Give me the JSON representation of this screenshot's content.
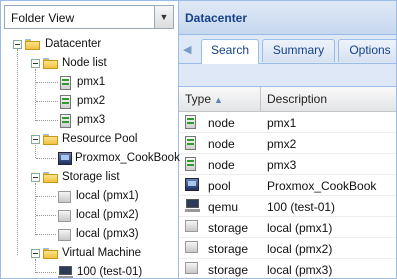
{
  "view_select": {
    "value": "Folder View"
  },
  "tree": {
    "root": "Datacenter",
    "node_list": {
      "label": "Node list",
      "items": [
        "pmx1",
        "pmx2",
        "pmx3"
      ]
    },
    "resource_pool": {
      "label": "Resource Pool",
      "items": [
        "Proxmox_CookBook"
      ]
    },
    "storage_list": {
      "label": "Storage list",
      "items": [
        "local (pmx1)",
        "local (pmx2)",
        "local (pmx3)"
      ]
    },
    "virtual_machine": {
      "label": "Virtual Machine",
      "items": [
        "100 (test-01)"
      ]
    }
  },
  "panel": {
    "title": "Datacenter",
    "tabs": [
      "Search",
      "Summary",
      "Options"
    ],
    "active_tab": "Search"
  },
  "grid": {
    "columns": [
      "Type",
      "Description"
    ],
    "rows": [
      {
        "icon": "server-icon",
        "type": "node",
        "description": "pmx1"
      },
      {
        "icon": "server-icon",
        "type": "node",
        "description": "pmx2"
      },
      {
        "icon": "server-icon",
        "type": "node",
        "description": "pmx3"
      },
      {
        "icon": "pool-icon",
        "type": "pool",
        "description": "Proxmox_CookBook"
      },
      {
        "icon": "vm-icon",
        "type": "qemu",
        "description": "100 (test-01)"
      },
      {
        "icon": "disk-icon",
        "type": "storage",
        "description": "local (pmx1)"
      },
      {
        "icon": "disk-icon",
        "type": "storage",
        "description": "local (pmx2)"
      },
      {
        "icon": "disk-icon",
        "type": "storage",
        "description": "local (pmx3)"
      }
    ]
  },
  "colors": {
    "border": "#99bce8",
    "header_text": "#15428b",
    "folder": "#f0c040"
  }
}
